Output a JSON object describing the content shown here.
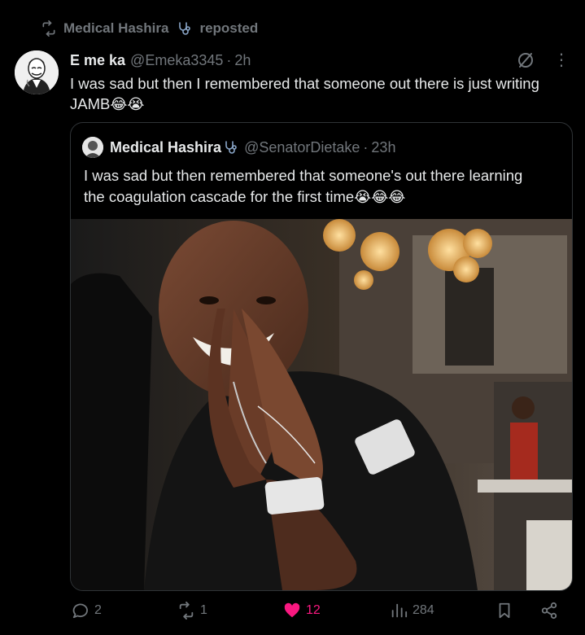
{
  "repost": {
    "user": "Medical Hashira",
    "label": "reposted"
  },
  "tweet": {
    "name": "E me ka",
    "handle": "@Emeka3345",
    "separator": "·",
    "time": "2h",
    "text_line1": "I was sad but then I remembered that someone out there is just writing",
    "text_line2": "JAMB",
    "text_emojis": "😂😭"
  },
  "quote": {
    "name": "Medical Hashira",
    "handle": "@SenatorDietake",
    "separator": "·",
    "time": "23h",
    "text_line1": "I was sad but then remembered that someone's out there learning",
    "text_line2": "the coagulation cascade for the first time",
    "text_emojis": "😭😂😂"
  },
  "actions": {
    "replies": "2",
    "reposts": "1",
    "likes": "12",
    "views": "284"
  },
  "colors": {
    "like": "#f91880",
    "muted": "#71767b",
    "text": "#e7e9ea",
    "border": "#2f3336"
  }
}
